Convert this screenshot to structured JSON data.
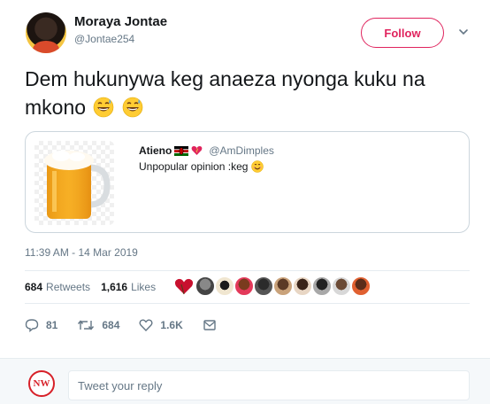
{
  "header": {
    "display_name": "Moraya Jontae",
    "handle": "@Jontae254",
    "follow_label": "Follow",
    "accent_color": "#e0245e"
  },
  "tweet": {
    "text": "Dem hukunywa keg anaeza nyonga kuku na mkono",
    "emoji": [
      "grinning-sweat-emoji",
      "grinning-sweat-emoji"
    ]
  },
  "quote": {
    "author": "Atieno",
    "author_badges": [
      "kenya-flag-emoji",
      "heart-emoji"
    ],
    "handle": "@AmDimples",
    "text": "Unpopular opinion :keg",
    "text_emoji": "smiling-emoji",
    "image": "beer-mug-image"
  },
  "timestamp": "11:39 AM - 14 Mar 2019",
  "stats": {
    "retweets_count": "684",
    "retweets_label": "Retweets",
    "likes_count": "1,616",
    "likes_label": "Likes"
  },
  "actions": {
    "reply_count": "81",
    "retweet_count": "684",
    "like_count": "1.6K"
  },
  "reply": {
    "avatar_text": "NW",
    "placeholder": "Tweet your reply"
  }
}
